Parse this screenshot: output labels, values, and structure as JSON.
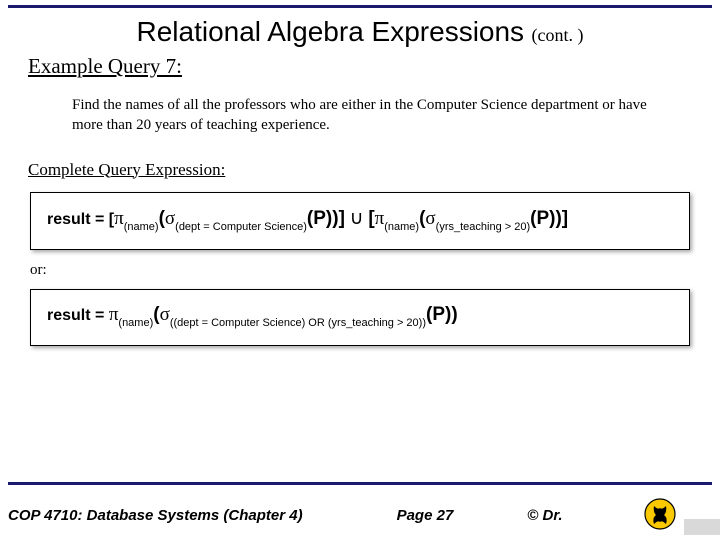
{
  "title": {
    "main": "Relational Algebra Expressions",
    "cont": "(cont. )"
  },
  "subheading": "Example Query 7:",
  "prompt": "Find the names of all the professors who are either in the Computer Science department or have more than 20 years of teaching experience.",
  "section_label": "Complete Query Expression:",
  "expr1": {
    "lead": "result = [",
    "pi": "π",
    "sub_name": "(name)",
    "open": "(",
    "sigma": "σ",
    "sub_dept": "(dept = Computer Science)",
    "P": "(P))]",
    "union": " ∪ ",
    "open2": "[",
    "sub_yrs": "(yrs_teaching > 20)",
    "P2": "(P))]"
  },
  "or_label": "or:",
  "expr2": {
    "lead": "result = ",
    "pi": "π",
    "sub_name": "(name)",
    "open": "(",
    "sigma": "σ",
    "sub_combined": "((dept = Computer Science) OR (yrs_teaching > 20))",
    "P": "(P))"
  },
  "footer": {
    "left": "COP 4710: Database Systems  (Chapter 4)",
    "mid": "Page 27",
    "right": "© Dr."
  }
}
